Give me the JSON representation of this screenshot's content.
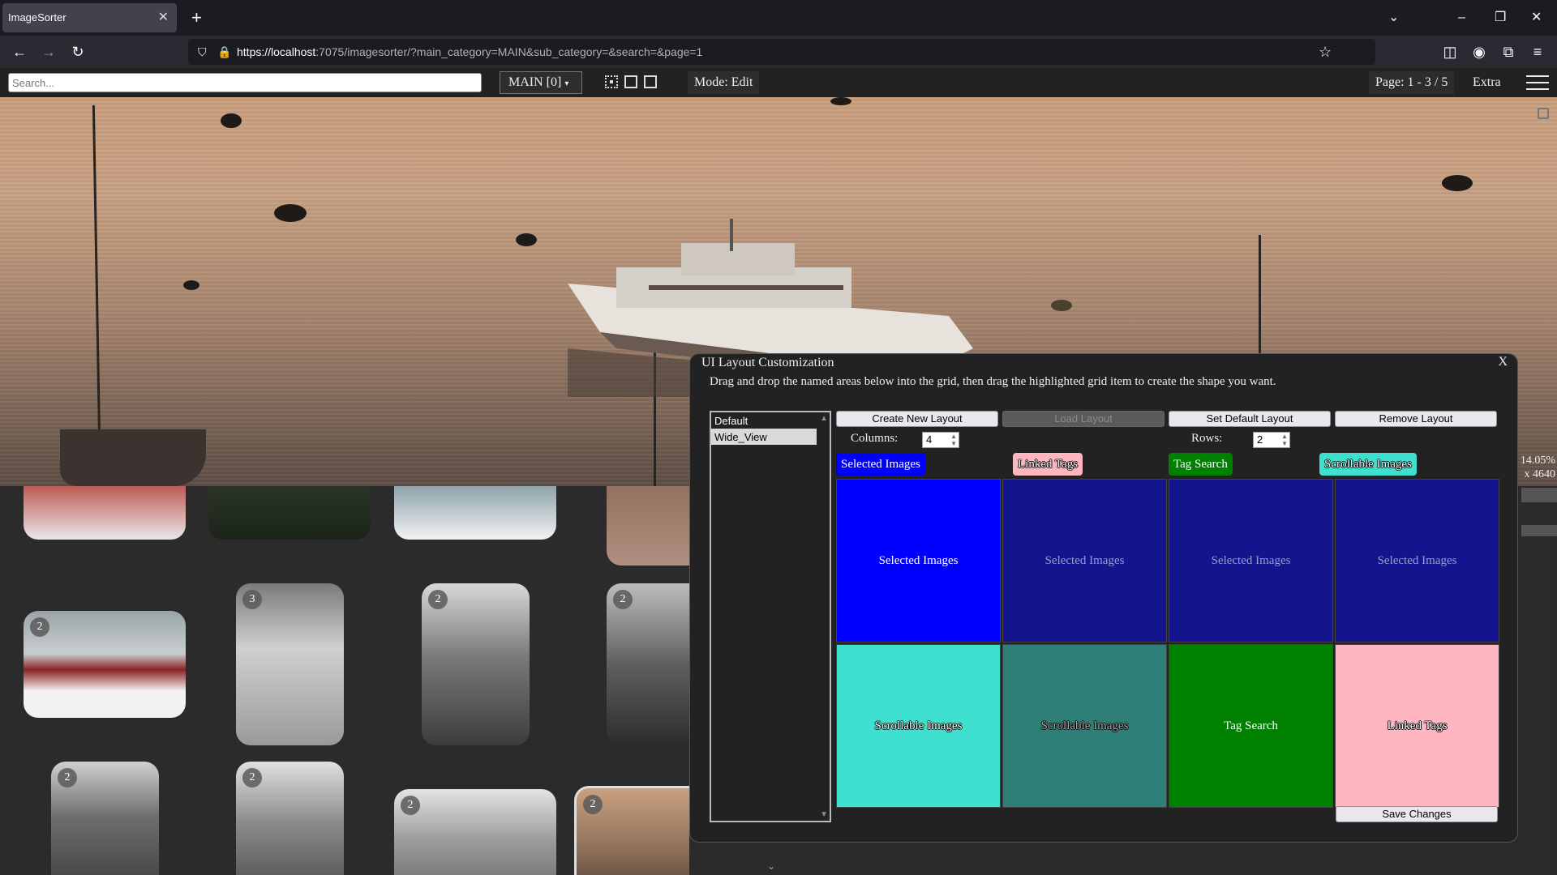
{
  "browser": {
    "tab_title": "ImageSorter",
    "tab_close": "✕",
    "new_tab": "+",
    "url_host": "https://localhost",
    "url_path": ":7075/imagesorter/?main_category=MAIN&sub_category=&search=&page=1",
    "window_controls": [
      "⌄",
      "–",
      "❐",
      "✕"
    ]
  },
  "toolbar": {
    "search_placeholder": "Search...",
    "category": "MAIN [0]",
    "mode": "Mode: Edit",
    "page": "Page: 1 - 3 / 5",
    "extra": "Extra"
  },
  "side_readout": {
    "zoom": "14.05%",
    "size": "x 4640"
  },
  "thumbnails": {
    "badges": [
      "2",
      "3",
      "2",
      "2",
      "2",
      "2",
      "2",
      "2"
    ]
  },
  "modal": {
    "title": "UI Layout Customization",
    "close": "X",
    "description": "Drag and drop the named areas below into the grid, then drag the highlighted grid item to create the shape you want.",
    "layouts": [
      "Default",
      "Wide_View"
    ],
    "selected_layout": "Wide_View",
    "buttons": {
      "create": "Create New Layout",
      "load": "Load Layout",
      "set_default": "Set Default Layout",
      "remove": "Remove Layout",
      "save": "Save Changes"
    },
    "columns_label": "Columns:",
    "columns_value": "4",
    "rows_label": "Rows:",
    "rows_value": "2",
    "areas": [
      {
        "label": "Selected Images",
        "color": "#0000ff"
      },
      {
        "label": "Linked Tags",
        "color": "#ffb6c1"
      },
      {
        "label": "Tag Search",
        "color": "#008000"
      },
      {
        "label": "Scrollable Images",
        "color": "#40e0d0"
      }
    ],
    "grid": [
      {
        "label": "Selected Images",
        "color": "#0000ff"
      },
      {
        "label": "Selected Images",
        "color": "#14148f"
      },
      {
        "label": "Selected Images",
        "color": "#14148f"
      },
      {
        "label": "Selected Images",
        "color": "#14148f"
      },
      {
        "label": "Scrollable Images",
        "color": "#40e0d0"
      },
      {
        "label": "Scrollable Images",
        "color": "#2e7f78"
      },
      {
        "label": "Tag Search",
        "color": "#008000"
      },
      {
        "label": "Linked Tags",
        "color": "#ffb6c1"
      }
    ]
  }
}
